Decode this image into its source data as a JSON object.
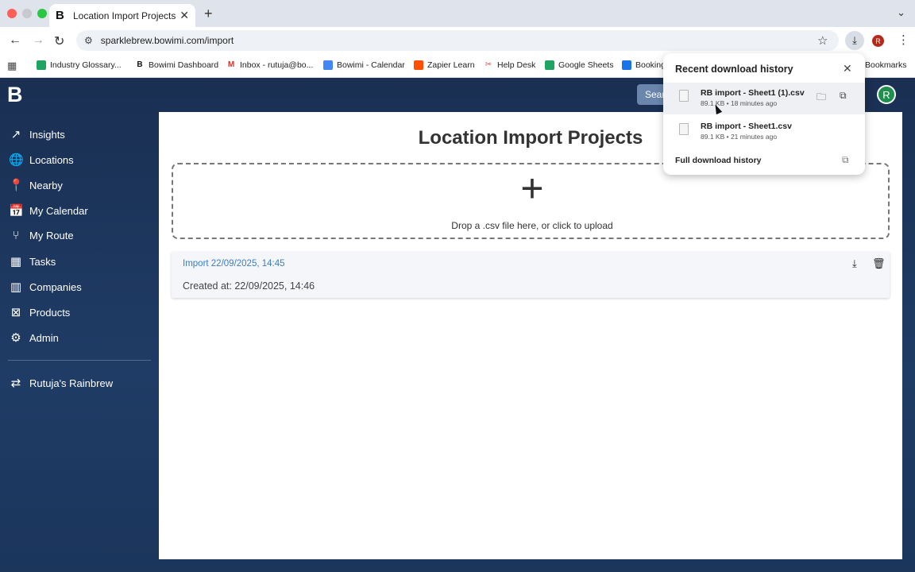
{
  "browser": {
    "tab_title": "Location Import Projects - Bo",
    "tab_logo": "B",
    "url": "sparklebrew.bowimi.com/import",
    "profile_letter": "R"
  },
  "bookmarks": [
    {
      "label": "Industry Glossary...",
      "color": "#1fa463"
    },
    {
      "label": "Bowimi Dashboard",
      "color": "#111111"
    },
    {
      "label": "Inbox - rutuja@bo...",
      "color": "#d93025"
    },
    {
      "label": "Bowimi - Calendar",
      "color": "#4285f4"
    },
    {
      "label": "Zapier Learn",
      "color": "#ff4f00"
    },
    {
      "label": "Help Desk",
      "color": "#e8453c"
    },
    {
      "label": "Google Sheets",
      "color": "#1fa463"
    },
    {
      "label": "Booking",
      "color": "#1a73e8"
    }
  ],
  "bookmarks_right": "Bookmarks",
  "app": {
    "logo": "B",
    "search_label": "Sear",
    "avatar_letter": "R",
    "nav": [
      {
        "label": "Insights",
        "icon": "trending-up-icon",
        "glyph": "↗"
      },
      {
        "label": "Locations",
        "icon": "globe-icon",
        "glyph": "🌐"
      },
      {
        "label": "Nearby",
        "icon": "map-pin-icon",
        "glyph": "📍"
      },
      {
        "label": "My Calendar",
        "icon": "calendar-icon",
        "glyph": "📅"
      },
      {
        "label": "My Route",
        "icon": "route-icon",
        "glyph": "⑂"
      },
      {
        "label": "Tasks",
        "icon": "tasks-icon",
        "glyph": "▦"
      },
      {
        "label": "Companies",
        "icon": "buildings-icon",
        "glyph": "▥"
      },
      {
        "label": "Products",
        "icon": "bookmark-icon",
        "glyph": "⊠"
      },
      {
        "label": "Admin",
        "icon": "gear-icon",
        "glyph": "⚙"
      }
    ],
    "org_switch": {
      "label": "Rutuja's Rainbrew",
      "icon": "swap-icon",
      "glyph": "⇄"
    }
  },
  "main": {
    "title": "Location Import Projects",
    "dropzone_text": "Drop a .csv file here, or click to upload",
    "imports": [
      {
        "name": "Import 22/09/2025, 14:45",
        "created": "Created at: 22/09/2025, 14:46"
      }
    ]
  },
  "downloads": {
    "title": "Recent download history",
    "items": [
      {
        "name": "RB import - Sheet1 (1).csv",
        "meta": "89.1 KB • 18 minutes ago"
      },
      {
        "name": "RB import - Sheet1.csv",
        "meta": "89.1 KB • 21 minutes ago"
      }
    ],
    "full_history": "Full download history"
  }
}
